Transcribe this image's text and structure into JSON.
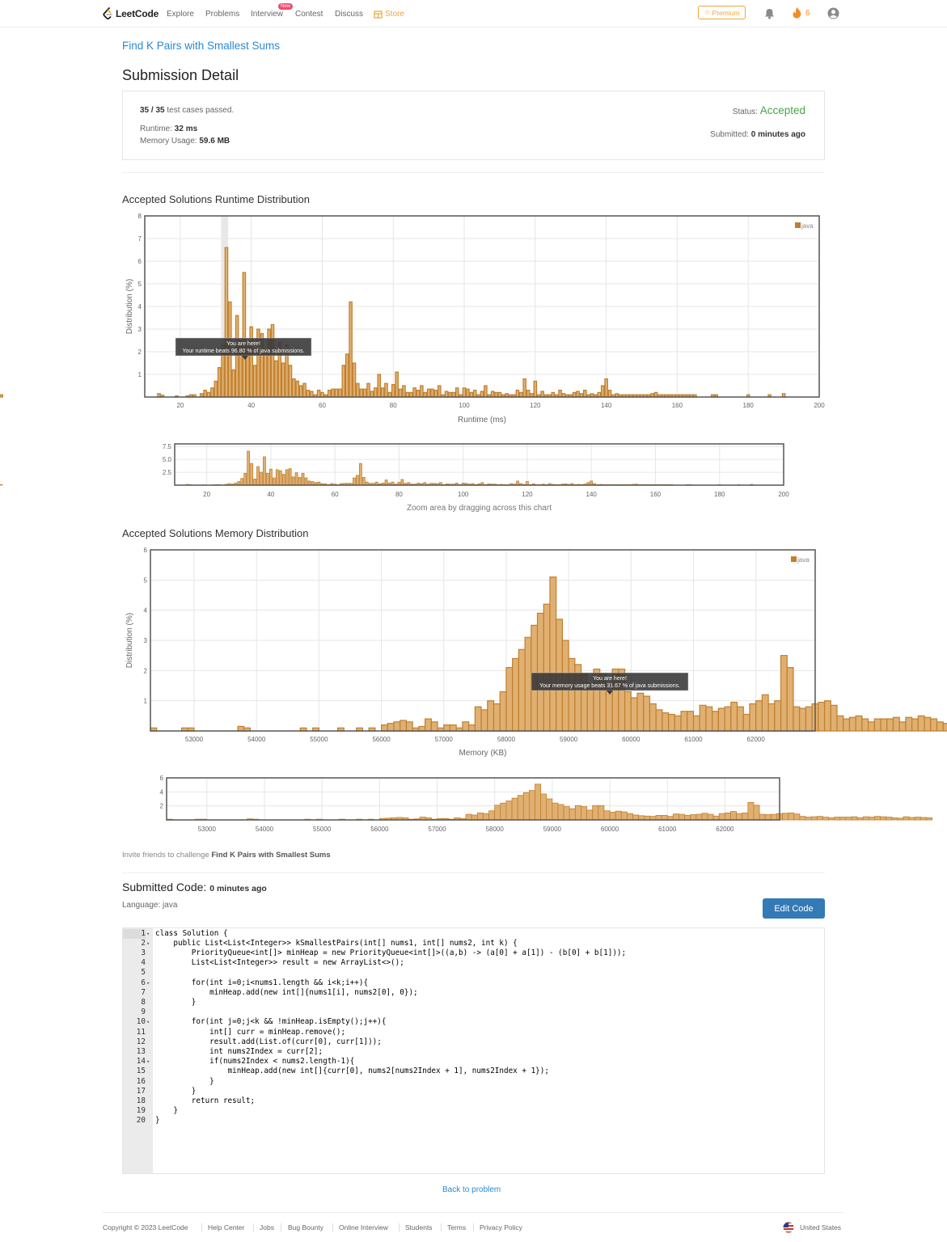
{
  "nav": {
    "brand": "LeetCode",
    "items": [
      "Explore",
      "Problems",
      "Interview",
      "Contest",
      "Discuss"
    ],
    "new_badge": "New",
    "store": "Store",
    "premium": "Premium",
    "streak": "6"
  },
  "problem": {
    "title": "Find K Pairs with Smallest Sums"
  },
  "page_title": "Submission Detail",
  "detail": {
    "passed": "35 / 35",
    "passed_suffix": "test cases passed.",
    "runtime_label": "Runtime:",
    "runtime_value": "32 ms",
    "memory_label": "Memory Usage:",
    "memory_value": "59.6 MB",
    "status_label": "Status:",
    "status_value": "Accepted",
    "submitted_label": "Submitted:",
    "submitted_value": "0 minutes ago"
  },
  "runtime_section": {
    "title": "Accepted Solutions Runtime Distribution",
    "tooltip_line1": "You are here!",
    "tooltip_line2": "Your runtime beats 96.80 % of java submissions.",
    "zoom_caption": "Zoom area by dragging across this chart"
  },
  "memory_section": {
    "title": "Accepted Solutions Memory Distribution",
    "tooltip_line1": "You are here!",
    "tooltip_line2": "Your memory usage beats 31.67 % of java submissions.",
    "zoom_caption": "Zoom area by dragging across this chart"
  },
  "chart_data": [
    {
      "type": "bar",
      "xlabel": "Runtime (ms)",
      "ylabel": "Distribution (%)",
      "xlim": [
        10,
        200
      ],
      "ylim": [
        0,
        8
      ],
      "xticks": [
        20,
        40,
        60,
        80,
        100,
        120,
        140,
        160,
        180,
        200
      ],
      "yticks": [
        1,
        2,
        3,
        4,
        5,
        6,
        7,
        8
      ],
      "legend": "java",
      "legend_position": "top-right",
      "highlight_x": 32,
      "grid": true,
      "x": [
        14,
        15,
        19,
        22,
        23,
        24,
        26,
        27,
        28,
        29,
        30,
        31,
        32,
        33,
        34,
        35,
        36,
        37,
        38,
        39,
        40,
        41,
        42,
        43,
        44,
        45,
        46,
        47,
        48,
        49,
        50,
        51,
        52,
        53,
        54,
        55,
        56,
        57,
        58,
        59,
        60,
        61,
        62,
        63,
        64,
        65,
        66,
        67,
        68,
        69,
        70,
        71,
        72,
        73,
        74,
        75,
        76,
        77,
        78,
        79,
        80,
        81,
        82,
        83,
        84,
        85,
        86,
        87,
        88,
        89,
        90,
        91,
        92,
        93,
        94,
        95,
        96,
        97,
        98,
        99,
        100,
        101,
        102,
        103,
        104,
        105,
        106,
        107,
        108,
        109,
        110,
        111,
        112,
        113,
        114,
        115,
        116,
        117,
        118,
        119,
        120,
        121,
        122,
        123,
        124,
        125,
        126,
        127,
        128,
        129,
        130,
        131,
        132,
        133,
        134,
        135,
        136,
        137,
        138,
        139,
        140,
        141,
        142,
        143,
        144,
        145,
        146,
        147,
        148,
        149,
        150,
        151,
        152,
        153,
        154,
        155,
        156,
        157,
        158,
        159,
        160,
        161,
        162,
        163,
        164,
        165,
        170,
        171,
        180,
        186,
        190
      ],
      "values": [
        0.15,
        0.08,
        0.05,
        0.05,
        0.1,
        0.1,
        0.15,
        0.3,
        0.2,
        0.4,
        0.7,
        1.3,
        2.3,
        6.6,
        4.2,
        1.2,
        3.6,
        2.5,
        5.5,
        2.3,
        3.1,
        1.4,
        3.0,
        2.8,
        2.1,
        3.0,
        3.2,
        1.6,
        2.4,
        1.5,
        2.3,
        1.4,
        0.8,
        0.7,
        0.5,
        0.6,
        0.3,
        0.25,
        0.1,
        0.3,
        0.2,
        0.1,
        0.3,
        0.35,
        0.35,
        0.35,
        1.4,
        1.9,
        4.2,
        1.5,
        0.6,
        0.35,
        0.35,
        0.6,
        0.25,
        0.4,
        1.0,
        0.4,
        0.6,
        0.2,
        0.55,
        1.1,
        0.35,
        0.5,
        0.2,
        0.2,
        0.4,
        0.3,
        0.5,
        0.2,
        0.35,
        0.35,
        0.3,
        0.5,
        0.1,
        0.25,
        0.2,
        0.2,
        0.4,
        0.1,
        0.4,
        0.35,
        0.2,
        0.3,
        0.1,
        0.25,
        0.5,
        0.1,
        0.25,
        0.2,
        0.2,
        0.1,
        0.15,
        0.1,
        0.1,
        0.3,
        0.2,
        0.8,
        0.3,
        0.15,
        0.7,
        0.1,
        0.25,
        0.1,
        0.1,
        0.2,
        0.1,
        0.3,
        0.15,
        0.1,
        0.1,
        0.2,
        0.25,
        0.15,
        0.3,
        0.1,
        0.15,
        0.1,
        0.2,
        0.5,
        0.8,
        0.3,
        0.1,
        0.15,
        0.1,
        0.1,
        0.1,
        0.1,
        0.1,
        0.1,
        0.1,
        0.1,
        0.1,
        0.15,
        0.2,
        0.1,
        0.1,
        0.1,
        0.1,
        0.1,
        0.1,
        0.1,
        0.1,
        0.1,
        0.1,
        0.1,
        0.1,
        0.1,
        0.1,
        0.1,
        0.15,
        0.1
      ]
    },
    {
      "type": "bar",
      "xlabel": "Memory (KB)",
      "ylabel": "Distribution (%)",
      "xlim": [
        52300,
        62950
      ],
      "ylim": [
        0,
        6
      ],
      "xticks": [
        53000,
        54000,
        55000,
        56000,
        57000,
        58000,
        59000,
        60000,
        61000,
        62000
      ],
      "yticks": [
        1,
        2,
        3,
        4,
        5,
        6
      ],
      "legend": "java",
      "legend_position": "top-right",
      "highlight_x": 59600,
      "grid": true,
      "x_start": 52300,
      "bin_width": 100,
      "values": [
        0.1,
        0,
        0,
        0,
        0,
        0.1,
        0.1,
        0,
        0,
        0,
        0,
        0,
        0,
        0,
        0.15,
        0.1,
        0,
        0,
        0,
        0,
        0,
        0,
        0,
        0,
        0.1,
        0,
        0.1,
        0,
        0,
        0,
        0.1,
        0,
        0,
        0.1,
        0,
        0.1,
        0,
        0.2,
        0.25,
        0.3,
        0.35,
        0.3,
        0.1,
        0.15,
        0.4,
        0.3,
        0.1,
        0.2,
        0.2,
        0.1,
        0.3,
        0.2,
        0.8,
        0.7,
        1.0,
        0.9,
        1.3,
        2.1,
        2.4,
        2.7,
        3.1,
        3.5,
        3.9,
        4.2,
        5.1,
        3.7,
        3.0,
        2.4,
        2.2,
        1.9,
        1.6,
        2.05,
        1.9,
        1.4,
        2.05,
        2.05,
        1.3,
        1.1,
        1.25,
        1.15,
        0.9,
        0.7,
        0.6,
        0.55,
        0.5,
        0.65,
        0.65,
        0.5,
        0.85,
        0.8,
        0.65,
        0.75,
        0.8,
        0.95,
        0.8,
        0.55,
        0.9,
        1.0,
        1.2,
        0.9,
        1.0,
        2.5,
        2.1,
        0.8,
        0.75,
        0.8,
        0.9,
        0.95,
        1.0,
        0.85,
        0.5,
        0.4,
        0.45,
        0.5,
        0.4,
        0.3,
        0.4,
        0.4,
        0.4,
        0.45,
        0.3,
        0.45,
        0.4,
        0.5,
        0.45,
        0.4,
        0.3,
        0.25,
        0.45,
        0.35,
        0.4,
        0.35,
        0.3
      ]
    }
  ],
  "invite": {
    "prefix": "Invite friends to challenge",
    "problem": "Find K Pairs with Smallest Sums"
  },
  "submitted_code": {
    "title": "Submitted Code:",
    "time": "0 minutes ago",
    "language": "Language: java",
    "edit_button": "Edit Code",
    "lines": [
      "class Solution {",
      "    public List<List<Integer>> kSmallestPairs(int[] nums1, int[] nums2, int k) {",
      "        PriorityQueue<int[]> minHeap = new PriorityQueue<int[]>((a,b) -> (a[0] + a[1]) - (b[0] + b[1]));",
      "        List<List<Integer>> result = new ArrayList<>();",
      "",
      "        for(int i=0;i<nums1.length && i<k;i++){",
      "            minHeap.add(new int[]{nums1[i], nums2[0], 0});",
      "        }",
      "",
      "        for(int j=0;j<k && !minHeap.isEmpty();j++){",
      "            int[] curr = minHeap.remove();",
      "            result.add(List.of(curr[0], curr[1]));",
      "            int nums2Index = curr[2];",
      "            if(nums2Index < nums2.length-1){",
      "                minHeap.add(new int[]{curr[0], nums2[nums2Index + 1], nums2Index + 1});",
      "            }",
      "        }",
      "        return result;",
      "    }",
      "}"
    ],
    "fold_lines": [
      1,
      2,
      6,
      10,
      14
    ]
  },
  "back_link": "Back to problem",
  "footer": {
    "copyright": "Copyright © 2023 LeetCode",
    "links": [
      "Help Center",
      "Jobs",
      "Bug Bounty",
      "Online Interview",
      "Students",
      "Terms",
      "Privacy Policy"
    ],
    "region": "United States"
  }
}
